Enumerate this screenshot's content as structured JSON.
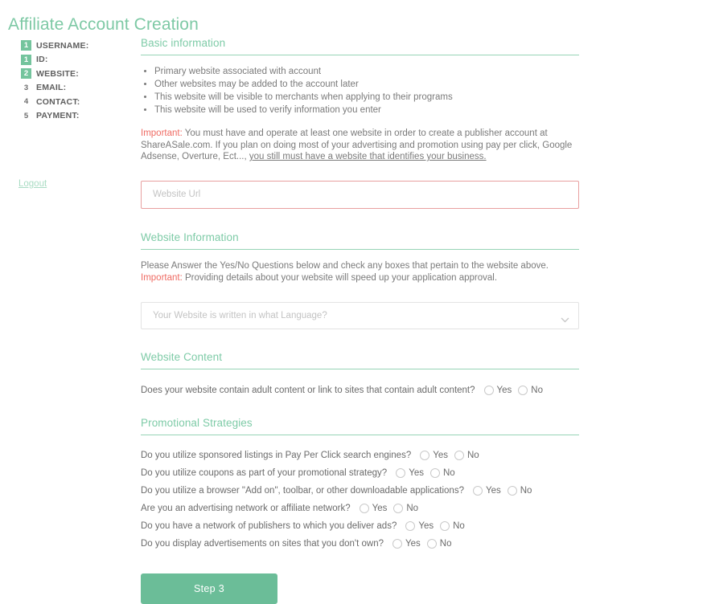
{
  "page": {
    "title": "Affiliate Account Creation"
  },
  "sidebar": {
    "steps": [
      {
        "number": "1",
        "label": "USERNAME:",
        "active": true
      },
      {
        "number": "1",
        "label": "ID:",
        "active": true
      },
      {
        "number": "2",
        "label": "WEBSITE:",
        "active": true
      },
      {
        "number": "3",
        "label": "EMAIL:",
        "active": false
      },
      {
        "number": "4",
        "label": "CONTACT:",
        "active": false
      },
      {
        "number": "5",
        "label": "PAYMENT:",
        "active": false
      }
    ],
    "logout_label": "Logout"
  },
  "basic_information": {
    "heading": "Basic information",
    "bullets": [
      "Primary website associated with account",
      "Other websites may be added to the account later",
      "This website will be visible to merchants when applying to their programs",
      "This website will be used to verify information you enter"
    ],
    "important_label": "Important:",
    "note_part1": " You must have and operate at least one website in order to create a publisher account at ShareASale.com. If you plan on doing most of your advertising and promotion using pay per click, Google Adsense, Overture, Ect..., ",
    "note_underlined": "you still must have a website that identifies your business."
  },
  "website_url_field": {
    "value": "",
    "placeholder": "Website Url"
  },
  "website_information": {
    "heading": "Website Information",
    "line1": "Please Answer the Yes/No Questions below and check any boxes that pertain to the website above.",
    "important_label": "Important:",
    "line2": " Providing details about your website will speed up your application approval.",
    "language_select": {
      "value": "Your Website is written in what Language?",
      "chevron_icon": "chevron-down-icon"
    }
  },
  "website_content": {
    "heading": "Website Content",
    "questions": [
      {
        "text": "Does your website contain adult content or link to sites that contain adult content?",
        "options": [
          "Yes",
          "No"
        ]
      }
    ]
  },
  "promotional_strategies": {
    "heading": "Promotional Strategies",
    "questions": [
      {
        "text": "Do you utilize sponsored listings in Pay Per Click search engines?",
        "options": [
          "Yes",
          "No"
        ]
      },
      {
        "text": "Do you utilize coupons as part of your promotional strategy?",
        "options": [
          "Yes",
          "No"
        ]
      },
      {
        "text": "Do you utilize a browser \"Add on\", toolbar, or other downloadable applications?",
        "options": [
          "Yes",
          "No"
        ]
      },
      {
        "text": "Are you an advertising network or affiliate network?",
        "options": [
          "Yes",
          "No"
        ]
      },
      {
        "text": "Do you have a network of publishers to which you deliver ads?",
        "options": [
          "Yes",
          "No"
        ]
      },
      {
        "text": "Do you display advertisements on sites that you don't own?",
        "options": [
          "Yes",
          "No"
        ]
      }
    ]
  },
  "submit": {
    "label": "Step 3"
  },
  "colors": {
    "accent_green": "#7ecba7",
    "button_green": "#6bbd98",
    "badge_green": "#74c49d",
    "important_red": "#ef6b63",
    "error_border": "#e8a0a0"
  }
}
